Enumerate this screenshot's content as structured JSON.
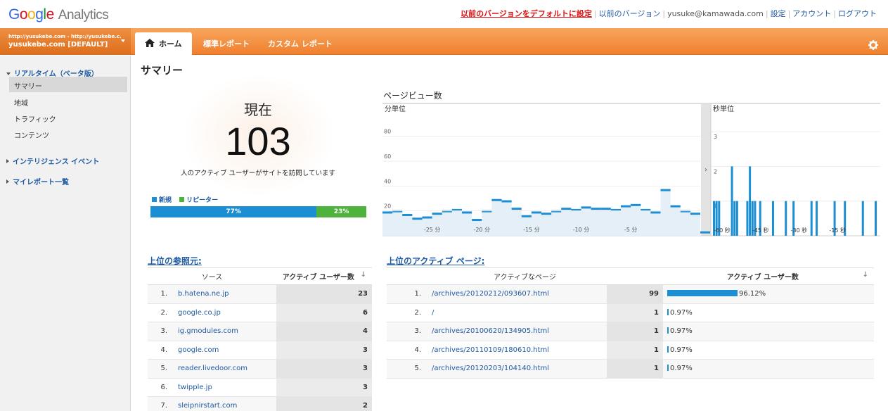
{
  "header": {
    "logo_google": "Google",
    "logo_analytics": "Analytics",
    "links": {
      "set_default": "以前のバージョンをデフォルトに設定",
      "old_version": "以前のバージョン",
      "user": "yusuke@kamawada.com",
      "settings": "設定",
      "account": "アカウント",
      "logout": "ログアウト"
    }
  },
  "account": {
    "urls": "http://yusukebe.com - http://yusukebe.c...",
    "name": "yusukebe.com [DEFAULT]"
  },
  "tabs": {
    "home": "ホーム",
    "standard": "標準レポート",
    "custom": "カスタム レポート"
  },
  "sidebar": {
    "realtime": "リアルタイム（ベータ版）",
    "items": [
      "サマリー",
      "地域",
      "トラフィック",
      "コンテンツ"
    ],
    "intelligence": "インテリジェンス イベント",
    "myreports": "マイレポート一覧"
  },
  "page_title": "サマリー",
  "now": {
    "label": "現在",
    "count": "103",
    "sub": "人のアクティブ ユーザーがサイトを訪問しています",
    "legend_new": "新規",
    "legend_returning": "リピーター",
    "new_pct_label": "77%",
    "returning_pct_label": "23%",
    "new_fraction": 0.77,
    "colors": {
      "new": "#1c8ed3",
      "returning": "#4db33d"
    }
  },
  "pageviews": {
    "title": "ページビュー数",
    "minute_label": "分単位",
    "second_label": "秒単位",
    "minute_y_ticks": [
      "80",
      "60",
      "40",
      "20"
    ],
    "minute_x_ticks": [
      "-25 分",
      "-20 分",
      "-15 分",
      "-10 分",
      "-5 分"
    ],
    "second_y_ticks": [
      "3",
      "2",
      "1"
    ],
    "second_x_ticks": [
      "-60 秒",
      "-45 秒",
      "-30 秒",
      "-15 秒"
    ]
  },
  "chart_data": [
    {
      "type": "area",
      "title": "分単位",
      "x": [
        -30,
        -29,
        -28,
        -27,
        -26,
        -25,
        -24,
        -23,
        -22,
        -21,
        -20,
        -19,
        -18,
        -17,
        -16,
        -15,
        -14,
        -13,
        -12,
        -11,
        -10,
        -9,
        -8,
        -7,
        -6,
        -5,
        -4,
        -3,
        -2,
        -1,
        0
      ],
      "values": [
        19,
        20,
        17,
        14,
        15,
        18,
        20,
        21,
        19,
        13,
        20,
        29,
        28,
        22,
        16,
        19,
        18,
        20,
        22,
        21,
        23,
        22,
        22,
        21,
        24,
        25,
        21,
        19,
        37,
        24,
        20,
        18,
        3
      ],
      "ylim": [
        0,
        90
      ],
      "color": "#1c8ed3"
    },
    {
      "type": "bar",
      "title": "秒単位",
      "x": [
        -63,
        -62,
        -61,
        -56,
        -55,
        -54,
        -50,
        -49,
        -48,
        -47,
        -45,
        -40,
        -35,
        -32,
        -25,
        -23,
        -16,
        -12,
        -5,
        0
      ],
      "values": [
        1,
        1,
        1,
        2,
        1,
        1,
        1,
        2,
        1,
        1,
        1,
        1,
        1,
        1,
        1,
        1,
        1,
        1,
        1,
        1
      ],
      "ylim": [
        0,
        3
      ],
      "color": "#1c8ed3"
    }
  ],
  "referrers": {
    "title": "上位の参照元:",
    "col_source": "ソース",
    "col_users": "アクティブ ユーザー数",
    "rows": [
      {
        "rank": "1.",
        "name": "b.hatena.ne.jp",
        "value": "23"
      },
      {
        "rank": "2.",
        "name": "google.co.jp",
        "value": "6"
      },
      {
        "rank": "3.",
        "name": "ig.gmodules.com",
        "value": "4"
      },
      {
        "rank": "4.",
        "name": "google.com",
        "value": "3"
      },
      {
        "rank": "5.",
        "name": "reader.livedoor.com",
        "value": "3"
      },
      {
        "rank": "6.",
        "name": "twipple.jp",
        "value": "3"
      },
      {
        "rank": "7.",
        "name": "sleipnirstart.com",
        "value": "2"
      }
    ]
  },
  "active_pages": {
    "title": "上位のアクティブ ページ:",
    "col_page": "アクティブなページ",
    "col_users": "アクティブ ユーザー数",
    "rows": [
      {
        "rank": "1.",
        "path": "/archives/20120212/093607.html",
        "value": "99",
        "pct": "96.12%",
        "fraction": 0.9612
      },
      {
        "rank": "2.",
        "path": "/",
        "value": "1",
        "pct": "0.97%",
        "fraction": 0.0097
      },
      {
        "rank": "3.",
        "path": "/archives/20100620/134905.html",
        "value": "1",
        "pct": "0.97%",
        "fraction": 0.0097
      },
      {
        "rank": "4.",
        "path": "/archives/20110109/180610.html",
        "value": "1",
        "pct": "0.97%",
        "fraction": 0.0097
      },
      {
        "rank": "5.",
        "path": "/archives/20120203/104140.html",
        "value": "1",
        "pct": "0.97%",
        "fraction": 0.0097
      }
    ]
  }
}
